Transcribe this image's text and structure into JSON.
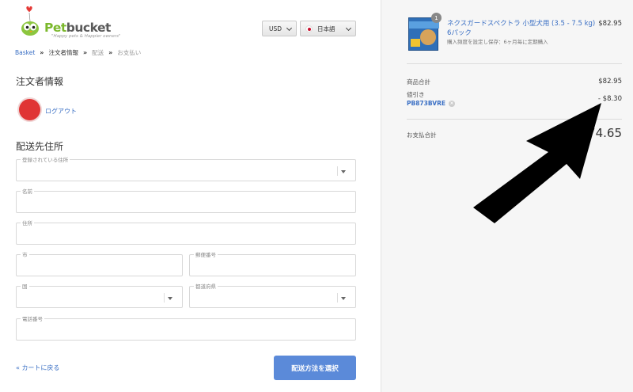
{
  "header": {
    "logo_text_1": "Pet",
    "logo_text_2": "bucket",
    "logo_tagline": "\"Happy pets & Happier owners\"",
    "currency": "USD",
    "language": "日本語"
  },
  "breadcrumb": {
    "basket": "Basket",
    "sep": "»",
    "customer_info": "注文者情報",
    "shipping": "配送",
    "payment": "お支払い"
  },
  "customer": {
    "title": "注文者情報",
    "logout": "ログアウト"
  },
  "shipping": {
    "title": "配送先住所",
    "saved_address_label": "登録されている住所",
    "name_label": "名前",
    "address_label": "住所",
    "city_label": "市",
    "postal_label": "郵便番号",
    "country_label": "国",
    "prefecture_label": "都道府県",
    "phone_label": "電話番号"
  },
  "footer": {
    "back": "« カートに戻る",
    "continue": "配送方法を選択"
  },
  "order": {
    "quantity": "1",
    "product_name": "ネクスガードスペクトラ 小型犬用 (3.5 - 7.5 kg) 6パック",
    "product_price": "$82.95",
    "product_note": "購入頻度を設定し保存：6ヶ月毎に定期購入",
    "subtotal_label": "商品合計",
    "subtotal": "$82.95",
    "discount_label": "値引き",
    "discount_code": "PB873BVRE",
    "discount_remove": "×",
    "discount": "- $8.30",
    "total_label": "お支払合計",
    "total": "$74.65"
  },
  "colors": {
    "link": "#3a6fc4",
    "button": "#5b8ad9",
    "avatar": "#e03434",
    "sidebar_bg": "#f6f6f6"
  }
}
